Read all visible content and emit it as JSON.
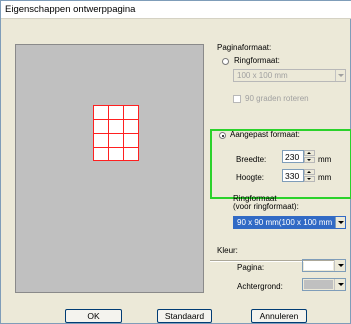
{
  "window": {
    "title": "Eigenschappen ontwerppagina"
  },
  "pagina_formaat": {
    "group_label": "Paginaformaat:",
    "ring_option_label": "Ringformaat:",
    "ring_size_value": "100 x 100 mm",
    "rotate_label": "90 graden roteren",
    "custom_option_label": "Aangepast formaat:",
    "width_label": "Breedte:",
    "width_value": "230",
    "height_label": "Hoogte:",
    "height_value": "330",
    "unit": "mm",
    "ring_note_line1": "Ringformaat",
    "ring_note_line2": "(voor ringformaat):",
    "ring_combo_value": "90 x 90 mm(100 x 100 mm"
  },
  "kleur": {
    "group_label": "Kleur:",
    "page_label": "Pagina:",
    "page_color": "#ffffff",
    "background_label": "Achtergrond:",
    "background_color": "#c0c0c0"
  },
  "buttons": {
    "ok": "OK",
    "standard": "Standaard",
    "cancel": "Annuleren"
  },
  "colors": {
    "highlight": "#2bd22b",
    "grid": "#ff2020",
    "selection": "#316ac5"
  }
}
